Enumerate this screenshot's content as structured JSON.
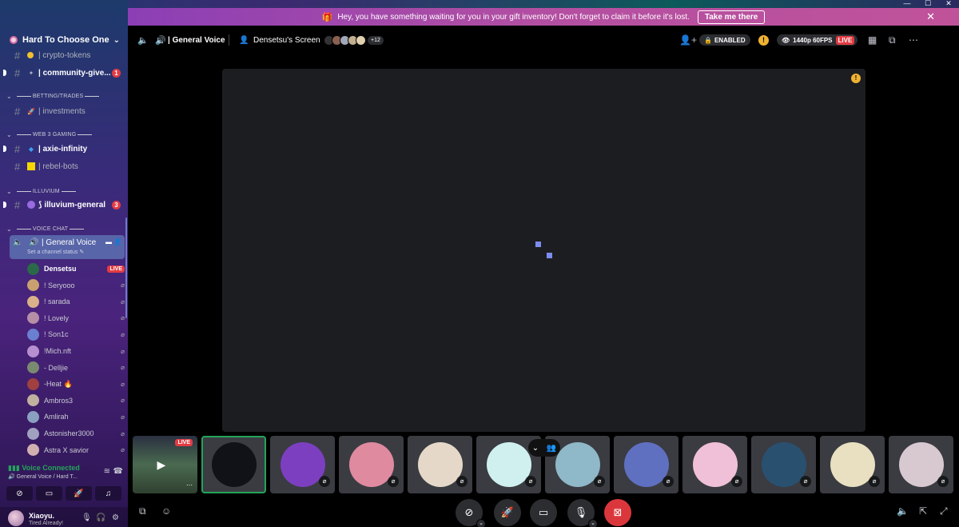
{
  "window": {
    "controls": [
      "—",
      "☐",
      "✕"
    ]
  },
  "banner": {
    "icon": "gift-icon",
    "text": "Hey, you have something waiting for you in your gift inventory! Don't forget to claim it before it's lost.",
    "button": "Take me there"
  },
  "server": {
    "name": "Hard To Choose One"
  },
  "channels": [
    {
      "label": "| crypto-tokens",
      "emoji": "🪙",
      "unread": false,
      "badge": null
    },
    {
      "label": "| community-give...",
      "emoji": "💸",
      "unread": true,
      "badge": "1"
    },
    {
      "label": "| investments",
      "emoji": "🚀",
      "unread": false,
      "badge": null
    },
    {
      "label": "| axie-infinity",
      "emoji": "🔷",
      "unread": true,
      "badge": null
    },
    {
      "label": "| rebel-bots",
      "emoji": "🟨",
      "unread": false,
      "badge": null
    },
    {
      "label": "⟆ illuvium-general",
      "emoji": "🟣",
      "unread": true,
      "badge": "3"
    }
  ],
  "categories": [
    "BETTING/TRADES",
    "WEB 3 GAMING",
    "ILLUVIUM",
    "VOICE CHAT"
  ],
  "voice_channel": {
    "name": "| General Voice",
    "status": "Set a channel status"
  },
  "members": [
    {
      "name": "Densetsu",
      "live": "LIVE",
      "color": "#2a6a4a"
    },
    {
      "name": "! Seryooo",
      "color": "#caa070"
    },
    {
      "name": "! sarada",
      "color": "#d9b08a"
    },
    {
      "name": "! Lovely",
      "color": "#b58fa8"
    },
    {
      "name": "! Son1c",
      "color": "#6a7fd0"
    },
    {
      "name": "!Mich.nft",
      "color": "#b78fd0"
    },
    {
      "name": "- Delljie",
      "color": "#7a8a70"
    },
    {
      "name": "-Heat 🔥",
      "color": "#a04040"
    },
    {
      "name": "Ambros3",
      "color": "#c0b0a0"
    },
    {
      "name": "Amlirah",
      "color": "#8aa0c0"
    },
    {
      "name": "Astonisher3000",
      "color": "#a0a0c0"
    },
    {
      "name": "Astra X savior",
      "color": "#d0b0b0"
    }
  ],
  "voice_panel": {
    "status": "Voice Connected",
    "sub": "General Voice / Hard T..."
  },
  "user": {
    "name": "Xiaoyu.",
    "status": "Tired Already!"
  },
  "header": {
    "channel": "| General Voice",
    "screen": "Densetsu's Screen",
    "more_count": "+12",
    "enabled": "ENABLED",
    "quality": "1440p 60FPS",
    "live": "LIVE"
  },
  "tiles": [
    {
      "kind": "stream",
      "live": "LIVE"
    },
    {
      "kind": "avatar",
      "color": "#111118",
      "selected": true
    },
    {
      "kind": "avatar",
      "color": "#7c3fc0"
    },
    {
      "kind": "avatar",
      "color": "#e08aa0"
    },
    {
      "kind": "avatar",
      "color": "#e6d8c8"
    },
    {
      "kind": "avatar",
      "color": "#d0f0f0"
    },
    {
      "kind": "avatar",
      "color": "#8fb8c8"
    },
    {
      "kind": "avatar",
      "color": "#6070c0"
    },
    {
      "kind": "avatar",
      "color": "#f0c0d8"
    },
    {
      "kind": "avatar",
      "color": "#2a5070"
    },
    {
      "kind": "avatar",
      "color": "#e8e0c0"
    },
    {
      "kind": "avatar",
      "color": "#d8c8d0"
    }
  ]
}
